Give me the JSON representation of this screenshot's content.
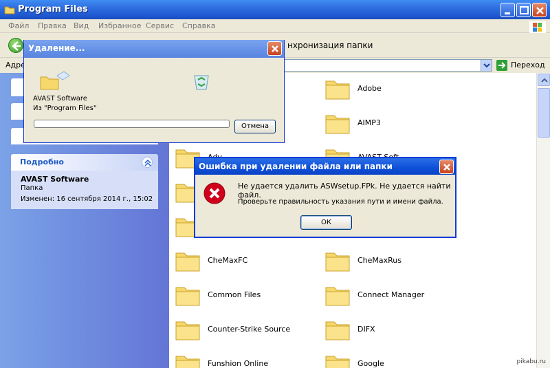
{
  "window": {
    "title": "Program Files"
  },
  "menu": [
    "Файл",
    "Правка",
    "Вид",
    "Избранное",
    "Сервис",
    "Справка"
  ],
  "toolbar": {
    "sync_label": "нхронизация папки"
  },
  "address": {
    "label": "Адре",
    "go_label": "Переход"
  },
  "taskpane": {
    "details_title": "Подробно",
    "item_name": "AVAST Software",
    "item_type": "Папка",
    "item_modified": "Изменен: 16 сентября 2014 г., 15:02"
  },
  "files": [
    {
      "name": "Adobe"
    },
    {
      "name": "AIMP3"
    },
    {
      "name": "Adv"
    },
    {
      "name": "AVAST Soft"
    },
    {
      "name": "CheMaxFC"
    },
    {
      "name": "CheMaxRus"
    },
    {
      "name": "Common Files"
    },
    {
      "name": "Connect Manager"
    },
    {
      "name": "Counter-Strike Source"
    },
    {
      "name": "DIFX"
    },
    {
      "name": "Funshion Online"
    },
    {
      "name": "Google"
    }
  ],
  "delete_dialog": {
    "title": "Удаление...",
    "item": "AVAST Software",
    "from": "Из \"Program Files\"",
    "cancel_label": "Отмена",
    "progress": 0
  },
  "error_dialog": {
    "title": "Ошибка при удалении файла или папки",
    "message": "Не удается удалить ASWsetup.FPk. Не удается найти файл.",
    "hint": "Проверьте правильность указания пути и имени файла.",
    "ok_label": "ОК"
  },
  "watermark": "pikabu.ru",
  "colors": {
    "title_blue": "#2f6ee0",
    "task_pane": "#7ba2e7",
    "dialog_face": "#ece9d8",
    "error_red": "#d0021b"
  }
}
